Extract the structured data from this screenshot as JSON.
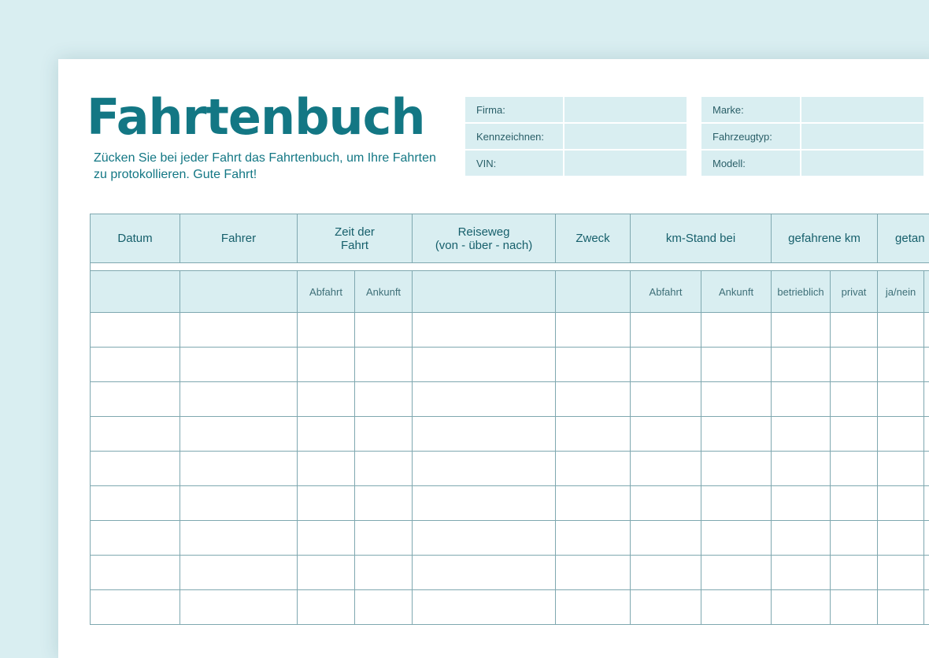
{
  "title": "Fahrtenbuch",
  "subtitle": "Zücken Sie bei jeder Fahrt das Fahrtenbuch, um Ihre Fahrten zu protokollieren. Gute Fahrt!",
  "company_fields": [
    {
      "label": "Firma:",
      "value": ""
    },
    {
      "label": "Kennzeichnen:",
      "value": ""
    },
    {
      "label": "VIN:",
      "value": ""
    }
  ],
  "vehicle_fields": [
    {
      "label": "Marke:",
      "value": ""
    },
    {
      "label": "Fahrzeugtyp:",
      "value": ""
    },
    {
      "label": "Modell:",
      "value": ""
    }
  ],
  "table": {
    "headers": [
      {
        "line1": "Datum",
        "line2": ""
      },
      {
        "line1": "Fahrer",
        "line2": ""
      },
      {
        "line1": "Zeit der",
        "line2": "Fahrt"
      },
      {
        "line1": "Reiseweg",
        "line2": "(von - über - nach)"
      },
      {
        "line1": "Zweck",
        "line2": ""
      },
      {
        "line1": "km-Stand bei",
        "line2": ""
      },
      {
        "line1": "gefahrene km",
        "line2": ""
      },
      {
        "line1": "getan",
        "line2": ""
      }
    ],
    "subheaders": [
      "",
      "",
      "Abfahrt",
      "Ankunft",
      "",
      "",
      "Abfahrt",
      "Ankunft",
      "betrieblich",
      "privat",
      "ja/nein",
      ""
    ]
  },
  "colors": {
    "background": "#d9eef1",
    "accent": "#137784",
    "cell_fill": "#d9eef1",
    "grid_line": "#7fa8b0"
  }
}
